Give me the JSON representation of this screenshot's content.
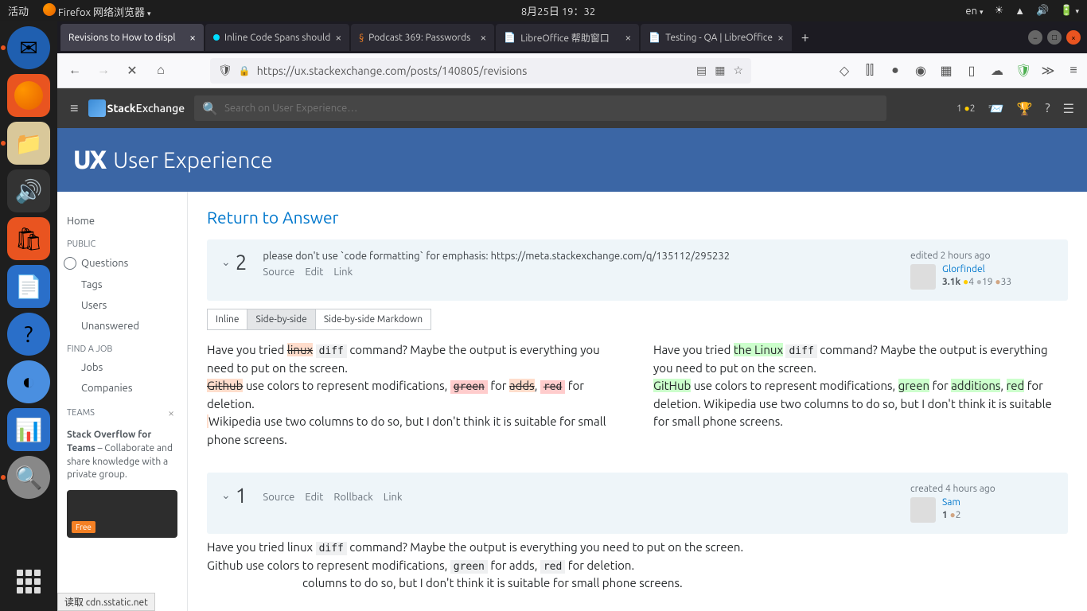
{
  "ubuntu": {
    "activities": "活动",
    "app_name": "Firefox 网络浏览器",
    "datetime": "8月25日  19：32",
    "lang": "en"
  },
  "tabs": {
    "t1": "Revisions to How to displ",
    "t2": "Inline Code Spans should",
    "t3": "Podcast 369: Passwords",
    "t4": "LibreOffice 帮助窗口",
    "t5": "Testing - QA | LibreOffice"
  },
  "url": "https://ux.stackexchange.com/posts/140805/revisions",
  "se": {
    "logo": "Exchange",
    "logo_pre": "Stack",
    "search_ph": "Search on User Experience…",
    "rep": "1",
    "bronze": "2"
  },
  "ux": {
    "title": "User Experience"
  },
  "nav": {
    "home": "Home",
    "public": "PUBLIC",
    "questions": "Questions",
    "tags": "Tags",
    "users": "Users",
    "unanswered": "Unanswered",
    "findjob": "FIND A JOB",
    "jobs": "Jobs",
    "companies": "Companies",
    "teams": "TEAMS",
    "teams_title": "Stack Overflow for Teams",
    "teams_desc": " – Collaborate and share knowledge with a private group.",
    "free": "Free"
  },
  "page": {
    "return": "Return to Answer"
  },
  "rev2": {
    "num": "2",
    "comment": "please don't use `code formatting` for emphasis: https://meta.stackexchange.com/q/135112/295232",
    "source": "Source",
    "edit": "Edit",
    "link": "Link",
    "edited": "edited 2 hours ago",
    "user": "Glorfindel",
    "rep": "3.1k",
    "gold": "4",
    "silver": "19",
    "bronze": "33"
  },
  "tabs_diff": {
    "inline": "Inline",
    "sbs": "Side-by-side",
    "sbsm": "Side-by-side Markdown"
  },
  "diff": {
    "l1a": "Have you tried ",
    "l1_del1": "linux",
    "l1b": " ",
    "l1_code": "diff",
    "l1c": " command? Maybe the output is everything you need to put on the screen.",
    "l2_del1": "Github",
    "l2a": " use colors to represent modifications, ",
    "l2_del2": "green",
    "l2b": " for ",
    "l2_del3": "adds",
    "l2c": ", ",
    "l2_del4": "red",
    "l2d": " for deletion.",
    "l3": " Wikipedia use two columns to do so, but I don't think it is suitable for small phone screens.",
    "r1a": "Have you tried ",
    "r1_ins1": "the Linux",
    "r1b": " ",
    "r1_code": "diff",
    "r1c": " command? Maybe the output is everything you need to put on the screen.",
    "r2_ins1": "GitHub",
    "r2a": " use colors to represent modifications, ",
    "r2_ins2": "green",
    "r2b": " for ",
    "r2_ins3": "additions",
    "r2c": ", ",
    "r2_ins4": "red",
    "r2d": " for deletion. Wikipedia use two columns to do so, but I don't think it is suitable for small phone screens."
  },
  "rev1": {
    "num": "1",
    "source": "Source",
    "edit": "Edit",
    "rollback": "Rollback",
    "link": "Link",
    "created": "created 4 hours ago",
    "user": "Sam",
    "rep": "1",
    "bronze": "2"
  },
  "orig": {
    "l1a": "Have you tried linux ",
    "l1_code": "diff",
    "l1b": " command? Maybe the output is everything you need to put on the screen.",
    "l2a": "Github use colors to represent modifications, ",
    "l2_c1": "green",
    "l2b": " for adds, ",
    "l2_c2": "red",
    "l2c": " for deletion.",
    "l3": "columns to do so, but I don't think it is suitable for small phone screens."
  },
  "status": "读取 cdn.sstatic.net"
}
